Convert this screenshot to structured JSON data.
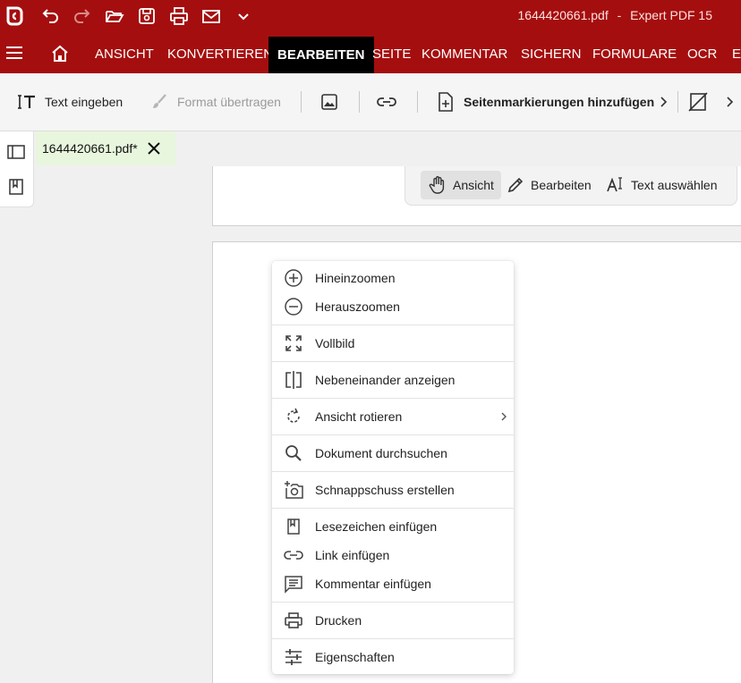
{
  "titlebar": {
    "filename": "1644420661.pdf",
    "separator": "-",
    "app_name": "Expert PDF 15"
  },
  "ribbon": {
    "tabs": [
      "ANSICHT",
      "KONVERTIEREN",
      "BEARBEITEN",
      "SEITE",
      "KOMMENTAR",
      "SICHERN",
      "FORMULARE",
      "OCR",
      "E-"
    ],
    "active_tab": "BEARBEITEN"
  },
  "toolbar": {
    "text_eingeben": "Text eingeben",
    "format_uebertragen": "Format übertragen",
    "seitenmarkierungen": "Seitenmarkierungen hinzufügen"
  },
  "document_tab": {
    "label": "1644420661.pdf*"
  },
  "modes": {
    "ansicht": "Ansicht",
    "bearbeiten": "Bearbeiten",
    "text_auswaehlen": "Text auswählen"
  },
  "context_menu": {
    "items": [
      {
        "label": "Hineinzoomen",
        "icon": "zoom-in-icon"
      },
      {
        "label": "Herauszoomen",
        "icon": "zoom-out-icon"
      },
      {
        "label": "Vollbild",
        "icon": "fullscreen-icon"
      },
      {
        "label": "Nebeneinander anzeigen",
        "icon": "side-by-side-icon"
      },
      {
        "label": "Ansicht rotieren",
        "icon": "rotate-icon",
        "submenu": true
      },
      {
        "label": "Dokument durchsuchen",
        "icon": "search-icon"
      },
      {
        "label": "Schnappschuss erstellen",
        "icon": "snapshot-icon"
      },
      {
        "label": "Lesezeichen einfügen",
        "icon": "bookmark-icon"
      },
      {
        "label": "Link einfügen",
        "icon": "link-icon"
      },
      {
        "label": "Kommentar einfügen",
        "icon": "comment-icon"
      },
      {
        "label": "Drucken",
        "icon": "print-icon"
      },
      {
        "label": "Eigenschaften",
        "icon": "properties-icon"
      }
    ]
  },
  "colors": {
    "brand_red": "#a50e0e",
    "active_tab_bg": "#000000",
    "doc_tab_bg": "#e8f6dd"
  }
}
